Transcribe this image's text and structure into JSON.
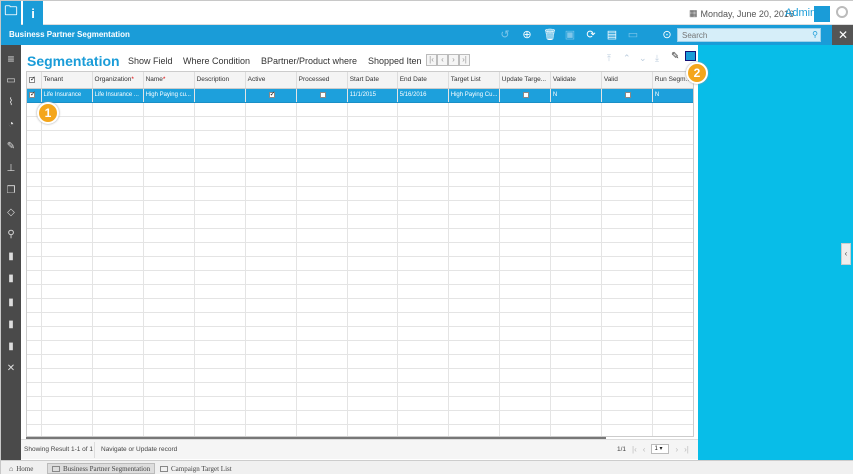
{
  "topbar": {
    "date": "Monday, June 20, 2016",
    "user": "Admin"
  },
  "header": {
    "window_title": "Business Partner Segmentation",
    "search_placeholder": "Search"
  },
  "main": {
    "title": "Segmentation",
    "tabs": [
      "Show Field",
      "Where Condition",
      "BPartner/Product where",
      "Shopped Iten"
    ]
  },
  "table": {
    "columns": [
      {
        "label": "Tenant",
        "required": false
      },
      {
        "label": "Organization",
        "required": true
      },
      {
        "label": "Name",
        "required": true
      },
      {
        "label": "Description",
        "required": false
      },
      {
        "label": "Active",
        "required": false
      },
      {
        "label": "Processed",
        "required": false
      },
      {
        "label": "Start Date",
        "required": false
      },
      {
        "label": "End Date",
        "required": false
      },
      {
        "label": "Target List",
        "required": false
      },
      {
        "label": "Update Targe...",
        "required": false
      },
      {
        "label": "Validate",
        "required": false
      },
      {
        "label": "Valid",
        "required": false
      },
      {
        "label": "Run Segm...",
        "required": false
      }
    ],
    "rows": [
      {
        "tenant": "Life Insurance",
        "organization": "Life Insurance ...",
        "name": "High Paying cu...",
        "description": "",
        "active": true,
        "processed": false,
        "start_date": "11/1/2015",
        "end_date": "5/16/2016",
        "target_list": "High Paying Cu...",
        "update_target": false,
        "validate": "N",
        "valid": false,
        "run_segment": "N"
      }
    ]
  },
  "footer": {
    "result": "Showing Result 1-1 of 1",
    "status": "Navigate or Update record",
    "page": "1/1",
    "page_select": "1"
  },
  "bottom_tabs": [
    "Home",
    "Business Partner Segmentation",
    "Campaign Target List"
  ],
  "callouts": [
    "1",
    "2"
  ],
  "colors": {
    "accent": "#1a9cd8",
    "panel": "#08bde8",
    "callout": "#f4a61b"
  }
}
